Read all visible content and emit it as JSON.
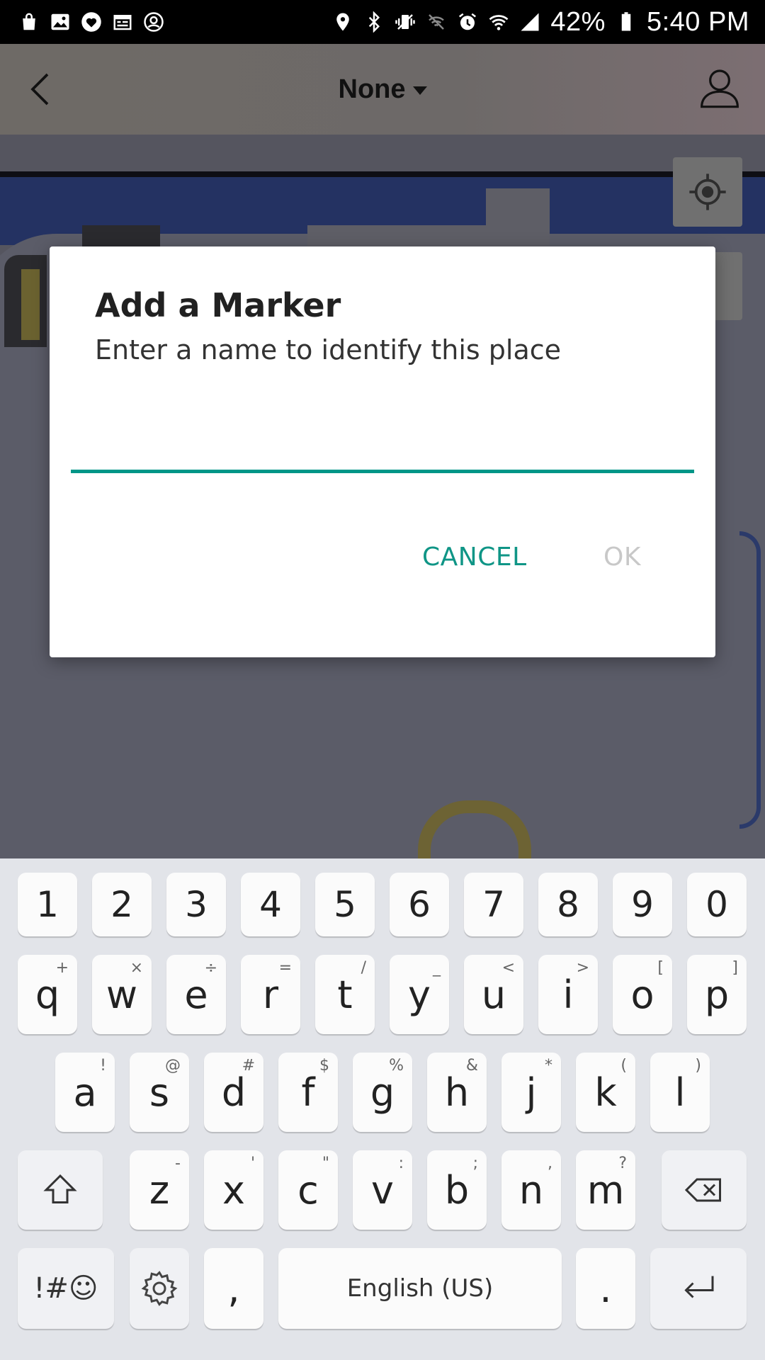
{
  "status_bar": {
    "battery": "42%",
    "time": "5:40 PM",
    "left_icons": [
      "shopping-bag-icon",
      "image-icon",
      "heart-icon",
      "calendar-icon",
      "account-circle-icon"
    ],
    "right_icons": [
      "location-icon",
      "bluetooth-icon",
      "vibrate-icon",
      "signal-off-icon",
      "alarm-icon",
      "wifi-icon",
      "cell-signal-icon",
      "battery-icon"
    ]
  },
  "header": {
    "title": "None",
    "back_icon": "chevron-left-icon",
    "profile_icon": "user-icon"
  },
  "map": {
    "locate_icon": "crosshair-icon"
  },
  "dialog": {
    "title": "Add a Marker",
    "subtitle": "Enter a name to identify this place",
    "input_value": "",
    "cancel_label": "CANCEL",
    "ok_label": "OK",
    "accent_color": "#009688"
  },
  "keyboard": {
    "number_row": [
      "1",
      "2",
      "3",
      "4",
      "5",
      "6",
      "7",
      "8",
      "9",
      "0"
    ],
    "row1": [
      {
        "key": "q",
        "hint": "+"
      },
      {
        "key": "w",
        "hint": "×"
      },
      {
        "key": "e",
        "hint": "÷"
      },
      {
        "key": "r",
        "hint": "="
      },
      {
        "key": "t",
        "hint": "/"
      },
      {
        "key": "y",
        "hint": "_"
      },
      {
        "key": "u",
        "hint": "<"
      },
      {
        "key": "i",
        "hint": ">"
      },
      {
        "key": "o",
        "hint": "["
      },
      {
        "key": "p",
        "hint": "]"
      }
    ],
    "row2": [
      {
        "key": "a",
        "hint": "!"
      },
      {
        "key": "s",
        "hint": "@"
      },
      {
        "key": "d",
        "hint": "#"
      },
      {
        "key": "f",
        "hint": "$"
      },
      {
        "key": "g",
        "hint": "%"
      },
      {
        "key": "h",
        "hint": "&"
      },
      {
        "key": "j",
        "hint": "*"
      },
      {
        "key": "k",
        "hint": "("
      },
      {
        "key": "l",
        "hint": ")"
      }
    ],
    "row3": [
      {
        "key": "z",
        "hint": "-"
      },
      {
        "key": "x",
        "hint": "'"
      },
      {
        "key": "c",
        "hint": "\""
      },
      {
        "key": "v",
        "hint": ":"
      },
      {
        "key": "b",
        "hint": ";"
      },
      {
        "key": "n",
        "hint": ","
      },
      {
        "key": "m",
        "hint": "?"
      }
    ],
    "symbols_label": "!#☺",
    "comma": ",",
    "space_label": "English (US)",
    "period": ".",
    "shift_icon": "shift-icon",
    "backspace_icon": "backspace-icon",
    "settings_icon": "gear-icon",
    "enter_icon": "enter-icon"
  }
}
